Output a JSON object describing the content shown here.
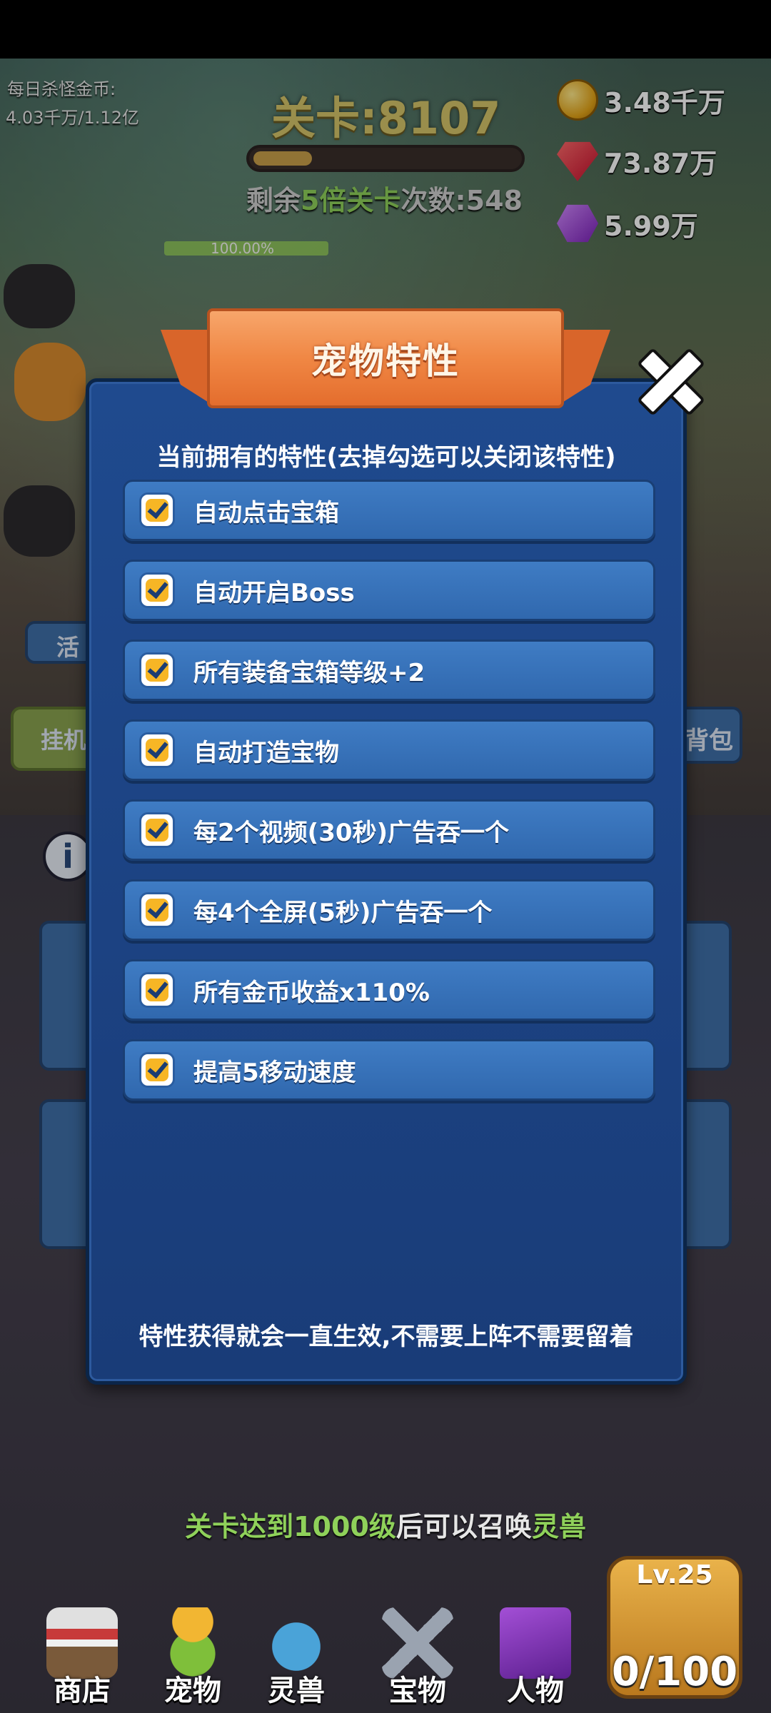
{
  "hud": {
    "daily_gold_label": "每日杀怪金币:",
    "daily_gold_value": "4.03千万/1.12亿",
    "stage_title": "关卡:8107",
    "stage_progress": 0.22,
    "remain_prefix": "剩余",
    "remain_highlight": "5倍关卡",
    "remain_suffix": "次数:548",
    "hp_text": "100.00%",
    "hp_fraction": 1.0
  },
  "resources": [
    {
      "icon": "gold-coin-icon",
      "value": "3.48千万"
    },
    {
      "icon": "ruby-icon",
      "value": "73.87万"
    },
    {
      "icon": "amethyst-icon",
      "value": "5.99万"
    }
  ],
  "modal": {
    "title": "宠物特性",
    "subtitle": "当前拥有的特性(去掉勾选可以关闭该特性)",
    "traits": [
      {
        "label": "自动点击宝箱",
        "checked": true
      },
      {
        "label": "自动开启Boss",
        "checked": true
      },
      {
        "label": "所有装备宝箱等级+2",
        "checked": true
      },
      {
        "label": "自动打造宝物",
        "checked": true
      },
      {
        "label": "每2个视频(30秒)广告吞一个",
        "checked": true
      },
      {
        "label": "每4个全屏(5秒)广告吞一个",
        "checked": true
      },
      {
        "label": "所有金币收益x110%",
        "checked": true
      },
      {
        "label": "提高5移动速度",
        "checked": true
      }
    ],
    "footer_note": "特性获得就会一直生效,不需要上阵不需要留着"
  },
  "unlock": {
    "prefix": "关卡达到1000级",
    "middle": "后可以召唤",
    "highlight": "灵兽"
  },
  "nav": [
    {
      "label": "商店",
      "icon": "shop-stall-icon"
    },
    {
      "label": "宠物",
      "icon": "cactus-pet-icon"
    },
    {
      "label": "灵兽",
      "icon": "spirit-beast-icon"
    },
    {
      "label": "宝物",
      "icon": "crossed-swords-icon"
    },
    {
      "label": "人物",
      "icon": "spellbook-icon"
    }
  ],
  "chest": {
    "level": "Lv.25",
    "count": "0/100"
  },
  "side": {
    "left_1": "活",
    "left_2": "挂机",
    "right_2": "背包"
  },
  "colors": {
    "accent_green": "#8fd15a",
    "checkbox_yellow": "#f7b625",
    "panel_blue": "#1f4a8e",
    "ribbon_orange": "#f08744"
  }
}
